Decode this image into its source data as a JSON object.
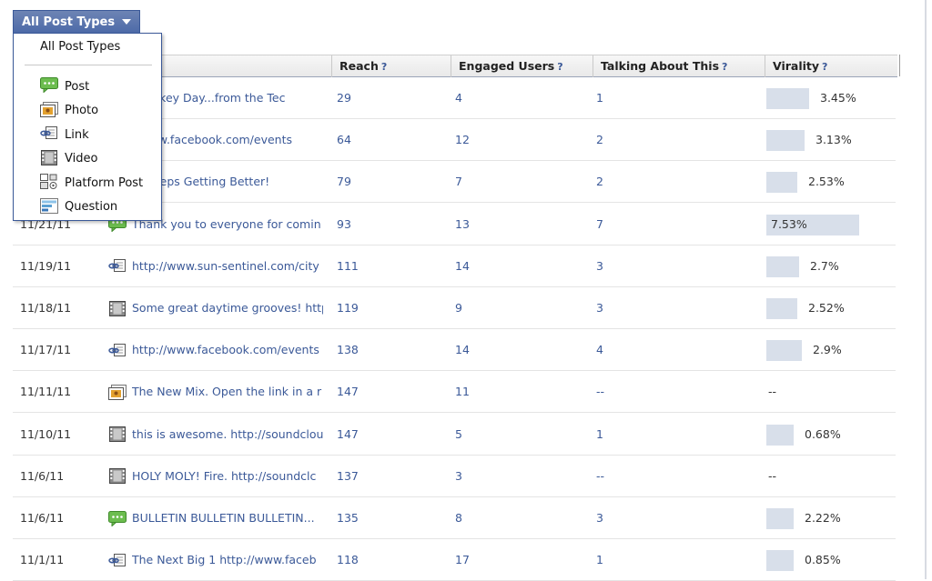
{
  "filter": {
    "label": "All Post Types"
  },
  "dropdown": {
    "all_label": "All Post Types",
    "items": [
      {
        "label": "Post",
        "icon": "post-icon"
      },
      {
        "label": "Photo",
        "icon": "photo-icon"
      },
      {
        "label": "Link",
        "icon": "link-icon"
      },
      {
        "label": "Video",
        "icon": "video-icon"
      },
      {
        "label": "Platform Post",
        "icon": "platform-post-icon"
      },
      {
        "label": "Question",
        "icon": "question-icon"
      }
    ]
  },
  "table": {
    "columns": [
      {
        "label": "Reach",
        "help": "?"
      },
      {
        "label": "Engaged Users",
        "help": "?"
      },
      {
        "label": "Talking About This",
        "help": "?"
      },
      {
        "label": "Virality",
        "help": "?"
      }
    ],
    "rows": [
      {
        "date": "",
        "type": "post",
        "message": "y Turkey Day...from the Tec",
        "reach": "29",
        "engaged": "4",
        "talking": "1",
        "virality": "3.45%",
        "virality_value": 3.45
      },
      {
        "date": "",
        "type": "link",
        "message": "//www.facebook.com/events",
        "reach": "64",
        "engaged": "12",
        "talking": "2",
        "virality": "3.13%",
        "virality_value": 3.13
      },
      {
        "date": "",
        "type": "post",
        "message": "st Keeps Getting Better!",
        "reach": "79",
        "engaged": "7",
        "talking": "2",
        "virality": "2.53%",
        "virality_value": 2.53
      },
      {
        "date": "11/21/11",
        "type": "post",
        "message": "Thank you to everyone for comin",
        "reach": "93",
        "engaged": "13",
        "talking": "7",
        "virality": "7.53%",
        "virality_value": 7.53
      },
      {
        "date": "11/19/11",
        "type": "link",
        "message": "http://www.sun-sentinel.com/city",
        "reach": "111",
        "engaged": "14",
        "talking": "3",
        "virality": "2.7%",
        "virality_value": 2.7
      },
      {
        "date": "11/18/11",
        "type": "video",
        "message": "Some great daytime grooves! http",
        "reach": "119",
        "engaged": "9",
        "talking": "3",
        "virality": "2.52%",
        "virality_value": 2.52
      },
      {
        "date": "11/17/11",
        "type": "link",
        "message": "http://www.facebook.com/events",
        "reach": "138",
        "engaged": "14",
        "talking": "4",
        "virality": "2.9%",
        "virality_value": 2.9
      },
      {
        "date": "11/11/11",
        "type": "photo",
        "message": "The New Mix. Open the link in a r",
        "reach": "147",
        "engaged": "11",
        "talking": "--",
        "virality": "--",
        "virality_value": null
      },
      {
        "date": "11/10/11",
        "type": "video",
        "message": "this is awesome. http://soundclou",
        "reach": "147",
        "engaged": "5",
        "talking": "1",
        "virality": "0.68%",
        "virality_value": 0.68
      },
      {
        "date": "11/6/11",
        "type": "video",
        "message": "HOLY MOLY! Fire. http://soundclc",
        "reach": "137",
        "engaged": "3",
        "talking": "--",
        "virality": "--",
        "virality_value": null
      },
      {
        "date": "11/6/11",
        "type": "post",
        "message": "BULLETIN BULLETIN BULLETIN...",
        "reach": "135",
        "engaged": "8",
        "talking": "3",
        "virality": "2.22%",
        "virality_value": 2.22
      },
      {
        "date": "11/1/11",
        "type": "link",
        "message": "The Next Big 1 http://www.faceb",
        "reach": "118",
        "engaged": "17",
        "talking": "1",
        "virality": "0.85%",
        "virality_value": 0.85
      }
    ]
  },
  "colors": {
    "link": "#3b5998",
    "bar": "#d8dfea",
    "button": "#4d6aa8",
    "post_icon": "#5fb14a"
  }
}
